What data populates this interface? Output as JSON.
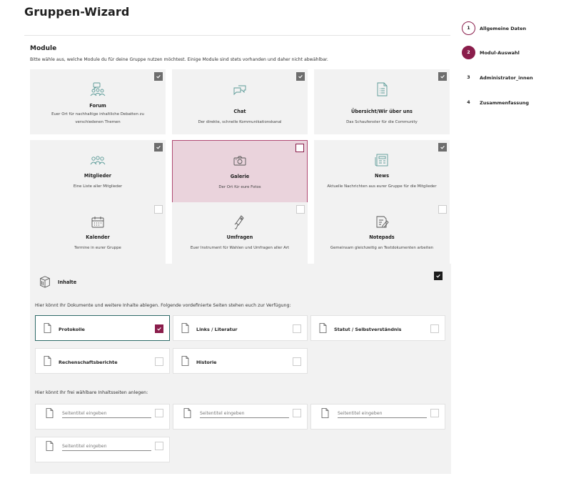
{
  "page": {
    "title": "Gruppen-Wizard"
  },
  "modules_section": {
    "title": "Module",
    "description": "Bitte wähle aus, welche Module du für deine Gruppe nutzen möchtest. Einige Module sind stets vorhanden und daher nicht abwählbar."
  },
  "modules": [
    {
      "name": "Forum",
      "description": "Euer Ort für nachhaltige inhaltliche Debatten zu verschiedenen Themen",
      "icon": "forum-icon",
      "checked": true
    },
    {
      "name": "Chat",
      "description": "Der direkte, schnelle Kommunikationskanal",
      "icon": "chat-icon",
      "checked": true
    },
    {
      "name": "Übersicht/Wir über uns",
      "description": "Das Schaufenster für die Community",
      "icon": "document-list-icon",
      "checked": true
    },
    {
      "name": "Mitglieder",
      "description": "Eine Liste aller Mitglieder",
      "icon": "members-icon",
      "checked": true
    },
    {
      "name": "Galerie",
      "description": "Der Ort für eure Fotos",
      "icon": "camera-icon",
      "checked": false
    },
    {
      "name": "News",
      "description": "Aktuelle Nachrichten aus eurer Gruppe für die Mitglieder",
      "icon": "newspaper-icon",
      "checked": true
    },
    {
      "name": "Kalender",
      "description": "Termine in eurer Gruppe",
      "icon": "calendar-icon",
      "checked": false
    },
    {
      "name": "Umfragen",
      "description": "Euer Instrument für Wahlen und Umfragen aller Art",
      "icon": "poll-icon",
      "checked": false
    },
    {
      "name": "Notepads",
      "description": "Gemeinsam gleichzeitig an Textdokumenten arbeiten",
      "icon": "notepad-icon",
      "checked": false
    }
  ],
  "content_section": {
    "title": "Inhalte",
    "intro": "Hier könnt Ihr Dokumente und weitere Inhalte ablegen. Folgende vordefinierte Seiten stehen euch zur Verfügung:",
    "pages": [
      {
        "label": "Protokolle",
        "checked": true
      },
      {
        "label": "Links / Literatur",
        "checked": false
      },
      {
        "label": "Statut / Selbstverständnis",
        "checked": false
      },
      {
        "label": "Rechenschaftsberichte",
        "checked": false
      },
      {
        "label": "Historie",
        "checked": false
      }
    ],
    "custom_intro": "Hier könnt Ihr frei wählbare Inhaltsseiten anlegen:",
    "custom_placeholder": "Seitentitel eingeben"
  },
  "steps": [
    {
      "number": "1",
      "label": "Allgemeine Daten"
    },
    {
      "number": "2",
      "label": "Modul-Auswahl"
    },
    {
      "number": "3",
      "label": "Administrator_innen"
    },
    {
      "number": "4",
      "label": "Zusammenfassung"
    }
  ],
  "colors": {
    "accent": "#8a1d4b",
    "selected_bg": "#ead3dc",
    "teal_icon": "#5a9a97",
    "panel_bg": "#f2f2f2"
  }
}
